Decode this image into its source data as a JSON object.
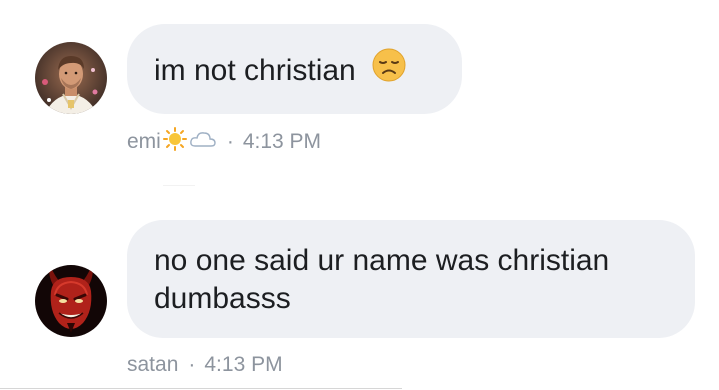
{
  "messages": [
    {
      "sender": "emi",
      "sender_emojis": [
        "sun-icon",
        "cloud-icon"
      ],
      "text": "im not christian",
      "trailing_emoji": "disappointed-face-icon",
      "separator": "·",
      "time": "4:13 PM"
    },
    {
      "sender": "satan",
      "text_line1": "no one said ur name was christian",
      "text_line2": "dumbasss",
      "separator": "·",
      "time": "4:13 PM"
    }
  ],
  "colors": {
    "bubble": "#eef0f4",
    "message_text": "#1c1e21",
    "meta_text": "#8d949e"
  }
}
